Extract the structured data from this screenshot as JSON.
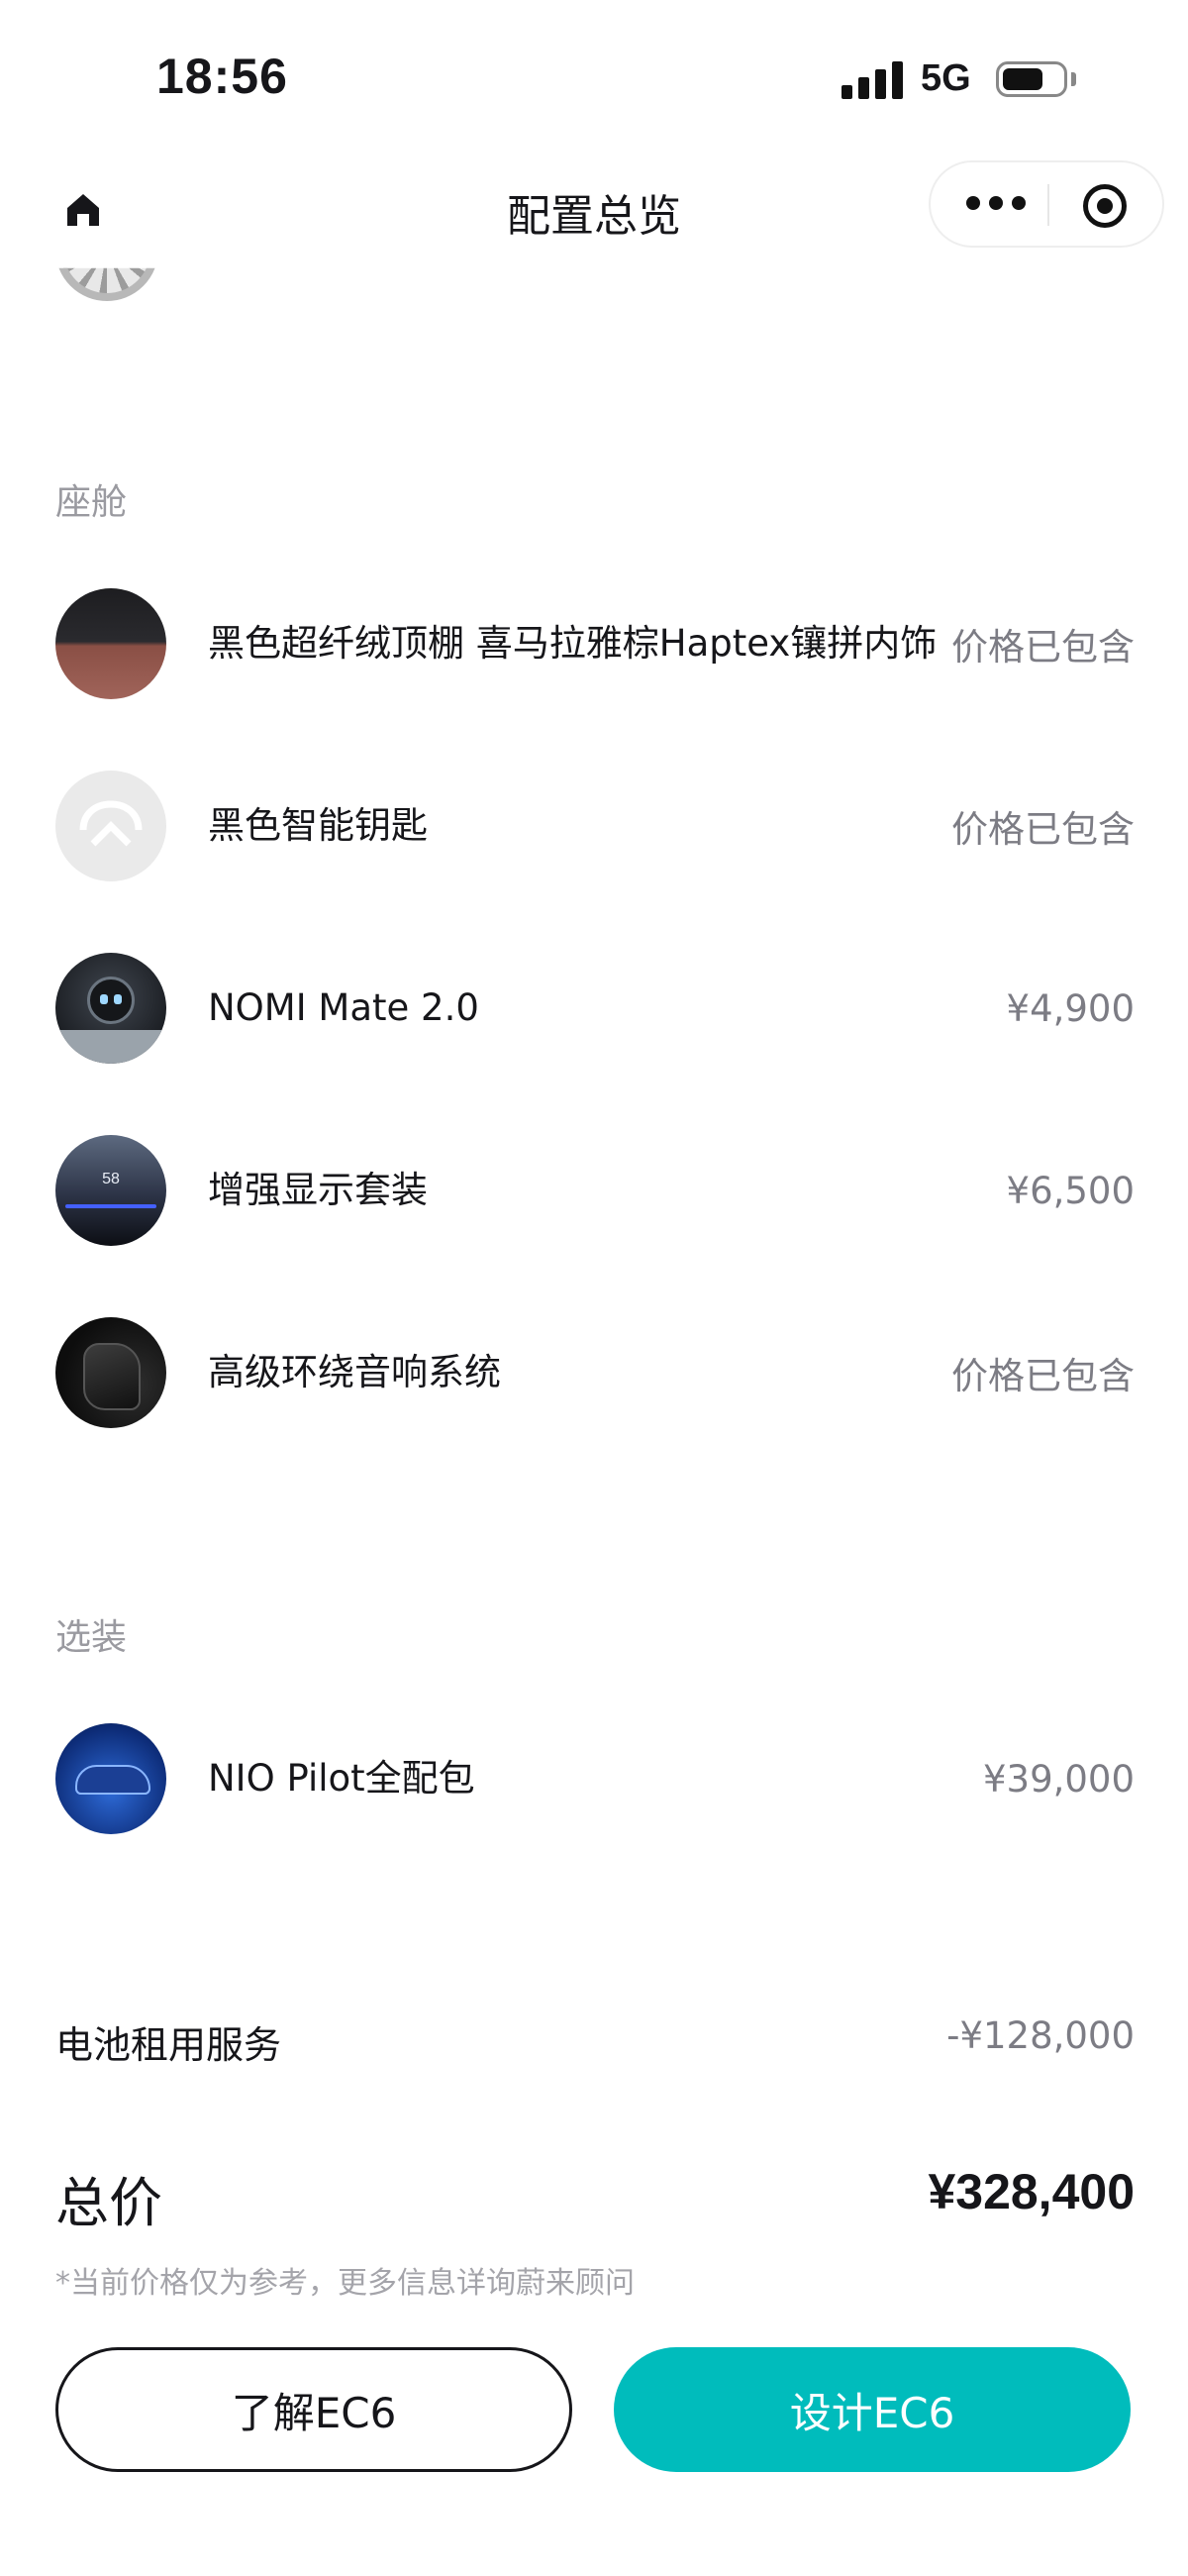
{
  "status_bar": {
    "time": "18:56",
    "network": "5G",
    "battery_level": 0.6
  },
  "nav": {
    "title": "配置总览",
    "home_icon": "home-icon",
    "more_icon": "more-icon",
    "close_icon": "target-close-icon"
  },
  "cabin": {
    "label": "座舱",
    "items": [
      {
        "name": "黑色超纤绒顶棚 喜马拉雅棕Haptex镶拼内饰",
        "price": "价格已包含"
      },
      {
        "name": "黑色智能钥匙",
        "price": "价格已包含"
      },
      {
        "name": "NOMI Mate 2.0",
        "price": "¥4,900"
      },
      {
        "name": "增强显示套装",
        "price": "¥6,500",
        "thumb_text": "58"
      },
      {
        "name": "高级环绕音响系统",
        "price": "价格已包含"
      }
    ]
  },
  "options": {
    "label": "选装",
    "items": [
      {
        "name": "NIO Pilot全配包",
        "price": "¥39,000"
      }
    ]
  },
  "battery_service": {
    "label": "电池租用服务",
    "value": "-¥128,000"
  },
  "total": {
    "label": "总价",
    "value": "¥328,400",
    "disclaimer": "*当前价格仅为参考，更多信息详询蔚来顾问"
  },
  "buttons": {
    "learn": "了解EC6",
    "design": "设计EC6"
  },
  "colors": {
    "accent": "#00bcbc",
    "text_primary": "#16161a",
    "text_secondary": "#7c7c84"
  }
}
